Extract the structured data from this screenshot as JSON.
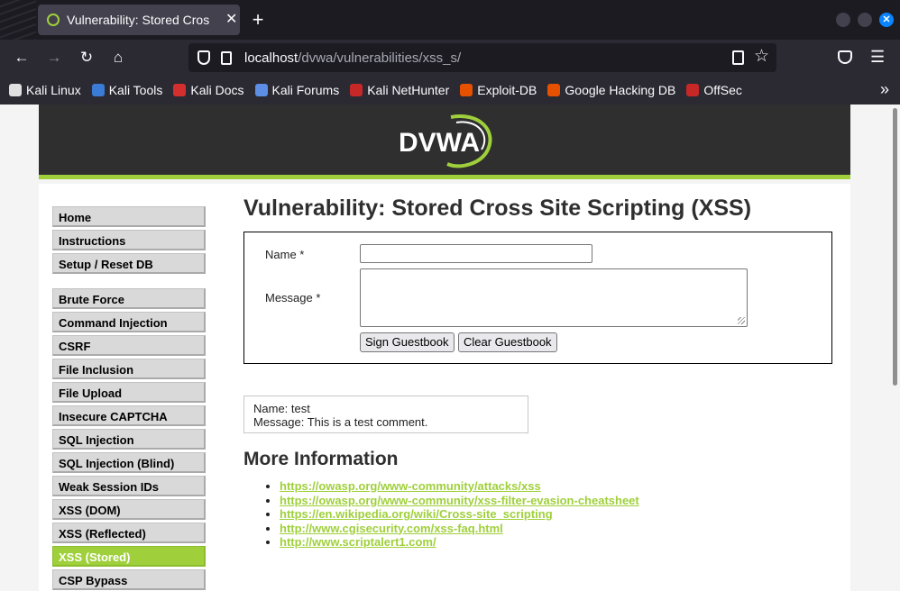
{
  "browser": {
    "tab_title": "Vulnerability: Stored Cros",
    "close_glyph": "✕",
    "new_tab_glyph": "+",
    "url_host": "localhost",
    "url_path": "/dvwa/vulnerabilities/xss_s/"
  },
  "bookmarks": [
    {
      "label": "Kali Linux",
      "icon": "kali-dragon-icon",
      "color": "#e0e0e0"
    },
    {
      "label": "Kali Tools",
      "icon": "kali-tools-icon",
      "color": "#3a7bd5"
    },
    {
      "label": "Kali Docs",
      "icon": "kali-docs-icon",
      "color": "#d32f2f"
    },
    {
      "label": "Kali Forums",
      "icon": "kali-forums-icon",
      "color": "#5c8ee6"
    },
    {
      "label": "Kali NetHunter",
      "icon": "nethunter-icon",
      "color": "#c62828"
    },
    {
      "label": "Exploit-DB",
      "icon": "exploit-db-icon",
      "color": "#e65100"
    },
    {
      "label": "Google Hacking DB",
      "icon": "ghdb-icon",
      "color": "#e65100"
    },
    {
      "label": "OffSec",
      "icon": "offsec-icon",
      "color": "#c62828"
    }
  ],
  "dvwa": {
    "logo_text": "DVWA",
    "accent_color": "#9fd03b",
    "menu_groups": [
      [
        "Home",
        "Instructions",
        "Setup / Reset DB"
      ],
      [
        "Brute Force",
        "Command Injection",
        "CSRF",
        "File Inclusion",
        "File Upload",
        "Insecure CAPTCHA",
        "SQL Injection",
        "SQL Injection (Blind)",
        "Weak Session IDs",
        "XSS (DOM)",
        "XSS (Reflected)",
        "XSS (Stored)",
        "CSP Bypass"
      ]
    ],
    "active_item": "XSS (Stored)",
    "page_title": "Vulnerability: Stored Cross Site Scripting (XSS)",
    "form": {
      "name_label": "Name *",
      "name_value": "",
      "message_label": "Message *",
      "message_value": "",
      "sign_button": "Sign Guestbook",
      "clear_button": "Clear Guestbook"
    },
    "guestbook_entry": {
      "name_line": "Name: test",
      "message_line": "Message: This is a test comment."
    },
    "more_info_title": "More Information",
    "links": [
      "https://owasp.org/www-community/attacks/xss",
      "https://owasp.org/www-community/xss-filter-evasion-cheatsheet",
      "https://en.wikipedia.org/wiki/Cross-site_scripting",
      "http://www.cgisecurity.com/xss-faq.html",
      "http://www.scriptalert1.com/"
    ]
  }
}
